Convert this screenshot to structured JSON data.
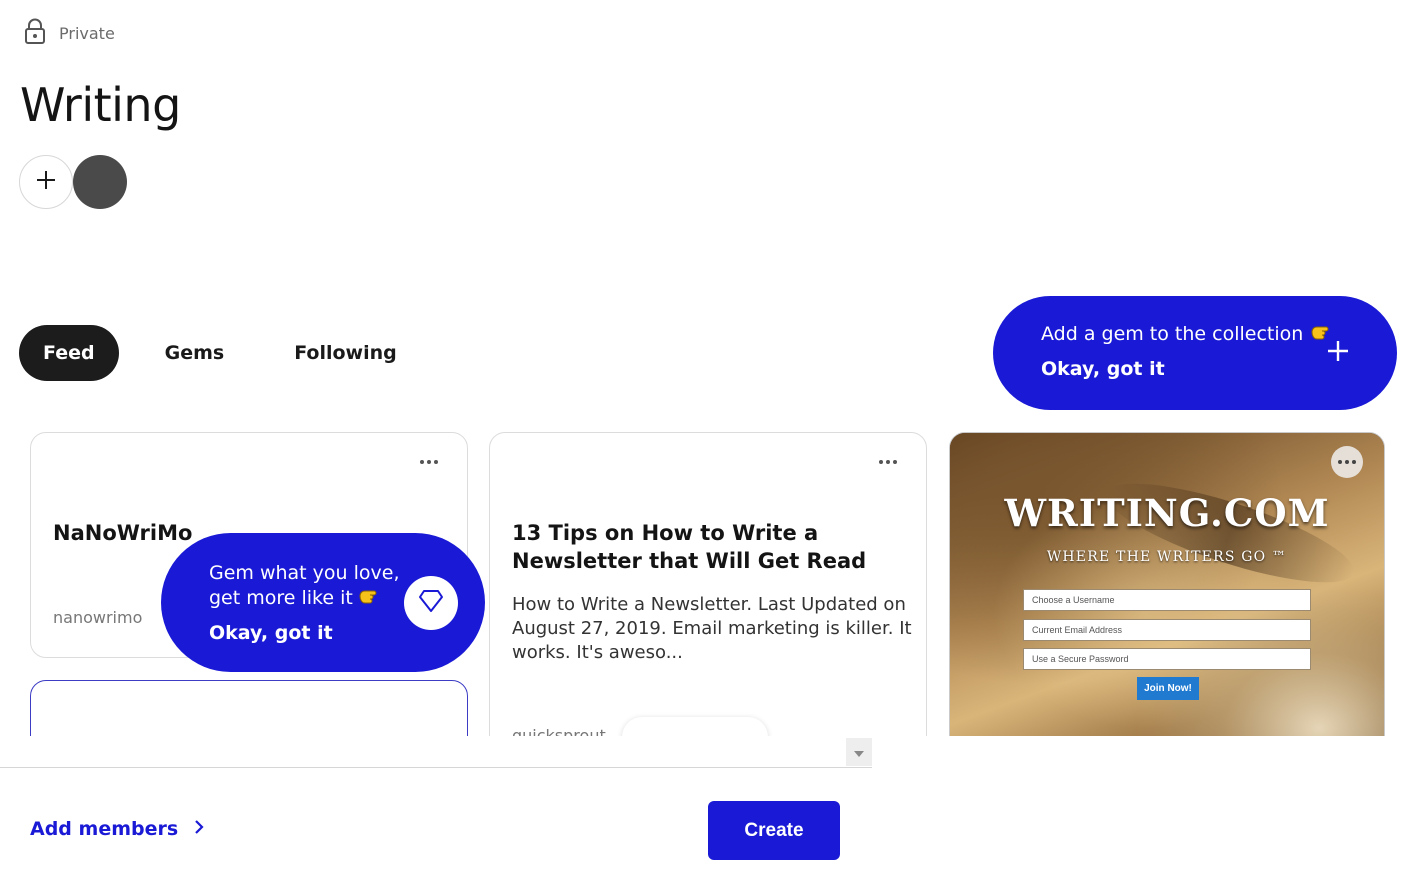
{
  "collection": {
    "privacy_label": "Private",
    "title": "Writing"
  },
  "tabs": [
    {
      "label": "Feed",
      "active": true
    },
    {
      "label": "Gems",
      "active": false
    },
    {
      "label": "Following",
      "active": false
    }
  ],
  "tooltips": {
    "add_gem": {
      "text": "Add a gem to the collection",
      "dismiss": "Okay, got it"
    },
    "gem_love": {
      "text": "Gem what you love, get more like it",
      "dismiss": "Okay, got it"
    }
  },
  "cards": [
    {
      "title": "NaNoWriMo",
      "source": "nanowrimo"
    },
    {
      "title": "13 Tips on How to Write a Newsletter that Will Get Read",
      "description": "How to Write a Newsletter. Last Updated on August 27, 2019. Email marketing is killer. It works. It's aweso...",
      "source": "quicksprout"
    },
    {
      "thumbnail": {
        "site_title": "WRITING.COM",
        "tagline": "WHERE THE WRITERS GO ™",
        "username_placeholder": "Choose a Username",
        "email_placeholder": "Current Email Address",
        "password_placeholder": "Use a Secure Password",
        "join_label": "Join Now!"
      }
    }
  ],
  "footer": {
    "add_members_label": "Add members",
    "create_label": "Create"
  },
  "colors": {
    "accent": "#1a1ad6",
    "active_tab": "#1c1c1c",
    "avatar": "#4a4a4a"
  },
  "icons": [
    "lock-icon",
    "plus-icon",
    "more-icon",
    "pointing-hand-icon",
    "gem-icon",
    "chevron-right-icon",
    "chevron-down-icon"
  ]
}
